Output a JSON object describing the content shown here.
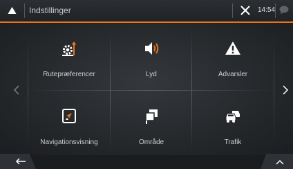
{
  "header": {
    "title": "Indstillinger",
    "clock": "14:54"
  },
  "tiles": [
    {
      "label": "Rutepræferencer",
      "icon": "route-preferences-icon"
    },
    {
      "label": "Lyd",
      "icon": "speaker-icon"
    },
    {
      "label": "Advarsler",
      "icon": "warning-icon"
    },
    {
      "label": "Navigationsvisning",
      "icon": "map-view-icon"
    },
    {
      "label": "Område",
      "icon": "map-region-icon"
    },
    {
      "label": "Trafik",
      "icon": "traffic-icon"
    }
  ],
  "colors": {
    "accent": "#e8731a",
    "icon": "#ffffff",
    "text": "#cdd0d2",
    "background": "#25282b"
  }
}
